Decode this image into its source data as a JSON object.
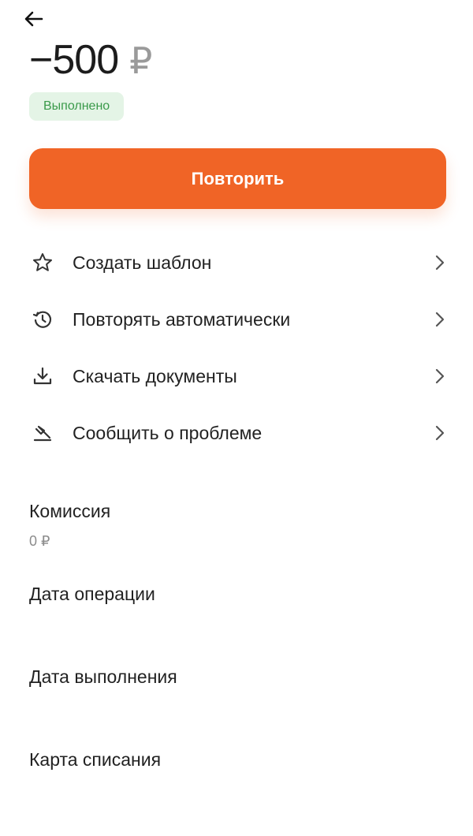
{
  "header": {
    "amount": "−500",
    "currency": "₽",
    "status": "Выполнено"
  },
  "primary_action": {
    "label": "Повторить"
  },
  "actions": [
    {
      "label": "Создать шаблон",
      "icon": "star-icon"
    },
    {
      "label": "Повторять автоматически",
      "icon": "history-icon"
    },
    {
      "label": "Скачать документы",
      "icon": "download-icon"
    },
    {
      "label": "Сообщить о проблеме",
      "icon": "report-problem-icon"
    }
  ],
  "details": {
    "commission": {
      "label": "Комиссия",
      "value": "0 ₽"
    },
    "operation_date": {
      "label": "Дата операции"
    },
    "execution_date": {
      "label": "Дата выполнения"
    },
    "debit_card": {
      "label": "Карта списания"
    }
  },
  "colors": {
    "accent": "#f06426",
    "status_bg": "#e4f4e6",
    "status_text": "#3a9a4a"
  }
}
